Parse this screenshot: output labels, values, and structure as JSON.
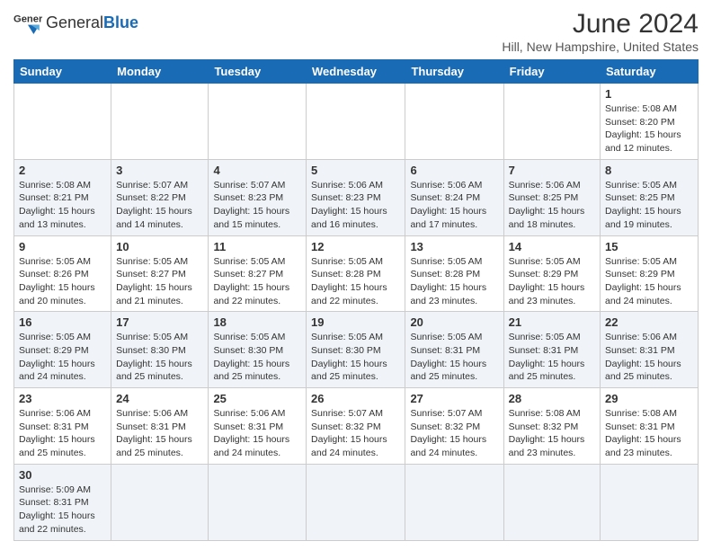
{
  "logo": {
    "text_general": "General",
    "text_blue": "Blue"
  },
  "title": "June 2024",
  "subtitle": "Hill, New Hampshire, United States",
  "days_of_week": [
    "Sunday",
    "Monday",
    "Tuesday",
    "Wednesday",
    "Thursday",
    "Friday",
    "Saturday"
  ],
  "weeks": [
    [
      {
        "day": "",
        "info": ""
      },
      {
        "day": "",
        "info": ""
      },
      {
        "day": "",
        "info": ""
      },
      {
        "day": "",
        "info": ""
      },
      {
        "day": "",
        "info": ""
      },
      {
        "day": "",
        "info": ""
      },
      {
        "day": "1",
        "info": "Sunrise: 5:08 AM\nSunset: 8:20 PM\nDaylight: 15 hours and 12 minutes."
      }
    ],
    [
      {
        "day": "2",
        "info": "Sunrise: 5:08 AM\nSunset: 8:21 PM\nDaylight: 15 hours and 13 minutes."
      },
      {
        "day": "3",
        "info": "Sunrise: 5:07 AM\nSunset: 8:22 PM\nDaylight: 15 hours and 14 minutes."
      },
      {
        "day": "4",
        "info": "Sunrise: 5:07 AM\nSunset: 8:23 PM\nDaylight: 15 hours and 15 minutes."
      },
      {
        "day": "5",
        "info": "Sunrise: 5:06 AM\nSunset: 8:23 PM\nDaylight: 15 hours and 16 minutes."
      },
      {
        "day": "6",
        "info": "Sunrise: 5:06 AM\nSunset: 8:24 PM\nDaylight: 15 hours and 17 minutes."
      },
      {
        "day": "7",
        "info": "Sunrise: 5:06 AM\nSunset: 8:25 PM\nDaylight: 15 hours and 18 minutes."
      },
      {
        "day": "8",
        "info": "Sunrise: 5:05 AM\nSunset: 8:25 PM\nDaylight: 15 hours and 19 minutes."
      }
    ],
    [
      {
        "day": "9",
        "info": "Sunrise: 5:05 AM\nSunset: 8:26 PM\nDaylight: 15 hours and 20 minutes."
      },
      {
        "day": "10",
        "info": "Sunrise: 5:05 AM\nSunset: 8:27 PM\nDaylight: 15 hours and 21 minutes."
      },
      {
        "day": "11",
        "info": "Sunrise: 5:05 AM\nSunset: 8:27 PM\nDaylight: 15 hours and 22 minutes."
      },
      {
        "day": "12",
        "info": "Sunrise: 5:05 AM\nSunset: 8:28 PM\nDaylight: 15 hours and 22 minutes."
      },
      {
        "day": "13",
        "info": "Sunrise: 5:05 AM\nSunset: 8:28 PM\nDaylight: 15 hours and 23 minutes."
      },
      {
        "day": "14",
        "info": "Sunrise: 5:05 AM\nSunset: 8:29 PM\nDaylight: 15 hours and 23 minutes."
      },
      {
        "day": "15",
        "info": "Sunrise: 5:05 AM\nSunset: 8:29 PM\nDaylight: 15 hours and 24 minutes."
      }
    ],
    [
      {
        "day": "16",
        "info": "Sunrise: 5:05 AM\nSunset: 8:29 PM\nDaylight: 15 hours and 24 minutes."
      },
      {
        "day": "17",
        "info": "Sunrise: 5:05 AM\nSunset: 8:30 PM\nDaylight: 15 hours and 25 minutes."
      },
      {
        "day": "18",
        "info": "Sunrise: 5:05 AM\nSunset: 8:30 PM\nDaylight: 15 hours and 25 minutes."
      },
      {
        "day": "19",
        "info": "Sunrise: 5:05 AM\nSunset: 8:30 PM\nDaylight: 15 hours and 25 minutes."
      },
      {
        "day": "20",
        "info": "Sunrise: 5:05 AM\nSunset: 8:31 PM\nDaylight: 15 hours and 25 minutes."
      },
      {
        "day": "21",
        "info": "Sunrise: 5:05 AM\nSunset: 8:31 PM\nDaylight: 15 hours and 25 minutes."
      },
      {
        "day": "22",
        "info": "Sunrise: 5:06 AM\nSunset: 8:31 PM\nDaylight: 15 hours and 25 minutes."
      }
    ],
    [
      {
        "day": "23",
        "info": "Sunrise: 5:06 AM\nSunset: 8:31 PM\nDaylight: 15 hours and 25 minutes."
      },
      {
        "day": "24",
        "info": "Sunrise: 5:06 AM\nSunset: 8:31 PM\nDaylight: 15 hours and 25 minutes."
      },
      {
        "day": "25",
        "info": "Sunrise: 5:06 AM\nSunset: 8:31 PM\nDaylight: 15 hours and 24 minutes."
      },
      {
        "day": "26",
        "info": "Sunrise: 5:07 AM\nSunset: 8:32 PM\nDaylight: 15 hours and 24 minutes."
      },
      {
        "day": "27",
        "info": "Sunrise: 5:07 AM\nSunset: 8:32 PM\nDaylight: 15 hours and 24 minutes."
      },
      {
        "day": "28",
        "info": "Sunrise: 5:08 AM\nSunset: 8:32 PM\nDaylight: 15 hours and 23 minutes."
      },
      {
        "day": "29",
        "info": "Sunrise: 5:08 AM\nSunset: 8:31 PM\nDaylight: 15 hours and 23 minutes."
      }
    ],
    [
      {
        "day": "30",
        "info": "Sunrise: 5:09 AM\nSunset: 8:31 PM\nDaylight: 15 hours and 22 minutes."
      },
      {
        "day": "",
        "info": ""
      },
      {
        "day": "",
        "info": ""
      },
      {
        "day": "",
        "info": ""
      },
      {
        "day": "",
        "info": ""
      },
      {
        "day": "",
        "info": ""
      },
      {
        "day": "",
        "info": ""
      }
    ]
  ]
}
